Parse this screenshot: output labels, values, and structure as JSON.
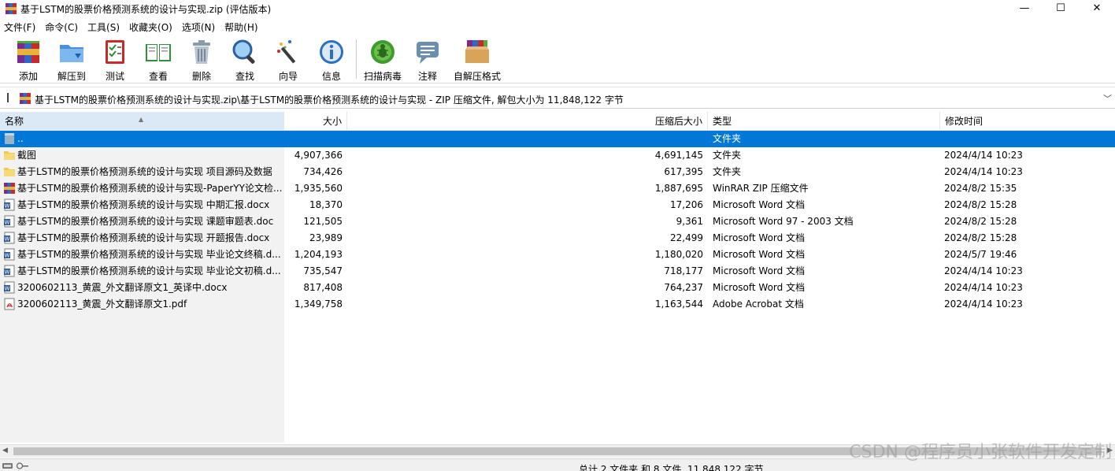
{
  "window": {
    "title": "基于LSTM的股票价格预测系统的设计与实现.zip (评估版本)",
    "minimize": "—",
    "maximize": "☐",
    "close": "✕"
  },
  "menu": [
    {
      "label": "文件(F)"
    },
    {
      "label": "命令(C)"
    },
    {
      "label": "工具(S)"
    },
    {
      "label": "收藏夹(O)"
    },
    {
      "label": "选项(N)"
    },
    {
      "label": "帮助(H)"
    }
  ],
  "toolbar": [
    {
      "label": "添加",
      "icon": "add-archive-icon"
    },
    {
      "label": "解压到",
      "icon": "extract-folder-icon"
    },
    {
      "label": "测试",
      "icon": "test-checklist-icon"
    },
    {
      "label": "查看",
      "icon": "view-book-icon"
    },
    {
      "label": "删除",
      "icon": "trash-can-icon"
    },
    {
      "label": "查找",
      "icon": "magnifier-icon"
    },
    {
      "label": "向导",
      "icon": "wizard-wand-icon"
    },
    {
      "label": "信息",
      "icon": "info-icon"
    },
    {
      "label": "扫描病毒",
      "icon": "virus-scan-icon"
    },
    {
      "label": "注释",
      "icon": "comment-icon"
    },
    {
      "label": "自解压格式",
      "icon": "sfx-box-icon"
    }
  ],
  "address": {
    "path": "基于LSTM的股票价格预测系统的设计与实现.zip\\基于LSTM的股票价格预测系统的设计与实现 - ZIP 压缩文件, 解包大小为 11,848,122 字节"
  },
  "columns": {
    "name": "名称",
    "size": "大小",
    "packed": "压缩后大小",
    "type": "类型",
    "modified": "修改时间"
  },
  "rows": [
    {
      "name": "..",
      "size": "",
      "packed": "",
      "type": "文件夹",
      "modified": "",
      "icon": "parent-folder-icon"
    },
    {
      "name": "截图",
      "size": "4,907,366",
      "packed": "4,691,145",
      "type": "文件夹",
      "modified": "2024/4/14 10:23",
      "icon": "folder-icon"
    },
    {
      "name": "基于LSTM的股票价格预测系统的设计与实现 项目源码及数据",
      "size": "734,426",
      "packed": "617,395",
      "type": "文件夹",
      "modified": "2024/4/14 10:23",
      "icon": "folder-icon"
    },
    {
      "name": "基于LSTM的股票价格预测系统的设计与实现-PaperYY论文检...",
      "size": "1,935,560",
      "packed": "1,887,695",
      "type": "WinRAR ZIP 压缩文件",
      "modified": "2024/8/2 15:35",
      "icon": "winrar-icon"
    },
    {
      "name": "基于LSTM的股票价格预测系统的设计与实现 中期汇报.docx",
      "size": "18,370",
      "packed": "17,206",
      "type": "Microsoft Word 文档",
      "modified": "2024/8/2 15:28",
      "icon": "word-doc-icon"
    },
    {
      "name": "基于LSTM的股票价格预测系统的设计与实现 课题审题表.doc",
      "size": "121,505",
      "packed": "9,361",
      "type": "Microsoft Word 97 - 2003 文档",
      "modified": "2024/8/2 15:28",
      "icon": "word-doc-icon"
    },
    {
      "name": "基于LSTM的股票价格预测系统的设计与实现 开题报告.docx",
      "size": "23,989",
      "packed": "22,499",
      "type": "Microsoft Word 文档",
      "modified": "2024/8/2 15:28",
      "icon": "word-doc-icon"
    },
    {
      "name": "基于LSTM的股票价格预测系统的设计与实现 毕业论文终稿.d...",
      "size": "1,204,193",
      "packed": "1,180,020",
      "type": "Microsoft Word 文档",
      "modified": "2024/5/7 19:46",
      "icon": "word-doc-icon"
    },
    {
      "name": "基于LSTM的股票价格预测系统的设计与实现 毕业论文初稿.d...",
      "size": "735,547",
      "packed": "718,177",
      "type": "Microsoft Word 文档",
      "modified": "2024/4/14 10:23",
      "icon": "word-doc-icon"
    },
    {
      "name": "3200602113_黄震_外文翻译原文1_英译中.docx",
      "size": "817,408",
      "packed": "764,237",
      "type": "Microsoft Word 文档",
      "modified": "2024/4/14 10:23",
      "icon": "word-doc-icon"
    },
    {
      "name": "3200602113_黄震_外文翻译原文1.pdf",
      "size": "1,349,758",
      "packed": "1,163,544",
      "type": "Adobe Acrobat 文档",
      "modified": "2024/4/14 10:23",
      "icon": "pdf-icon"
    }
  ],
  "status": {
    "text": "总计 2 文件夹 和 8 文件, 11,848,122 字节"
  },
  "watermark": "CSDN @程序员小张软件开发定制",
  "colors": {
    "selection": "#0078d7",
    "header_active": "#dbe9f7",
    "left_pane": "#f2f2f2"
  }
}
